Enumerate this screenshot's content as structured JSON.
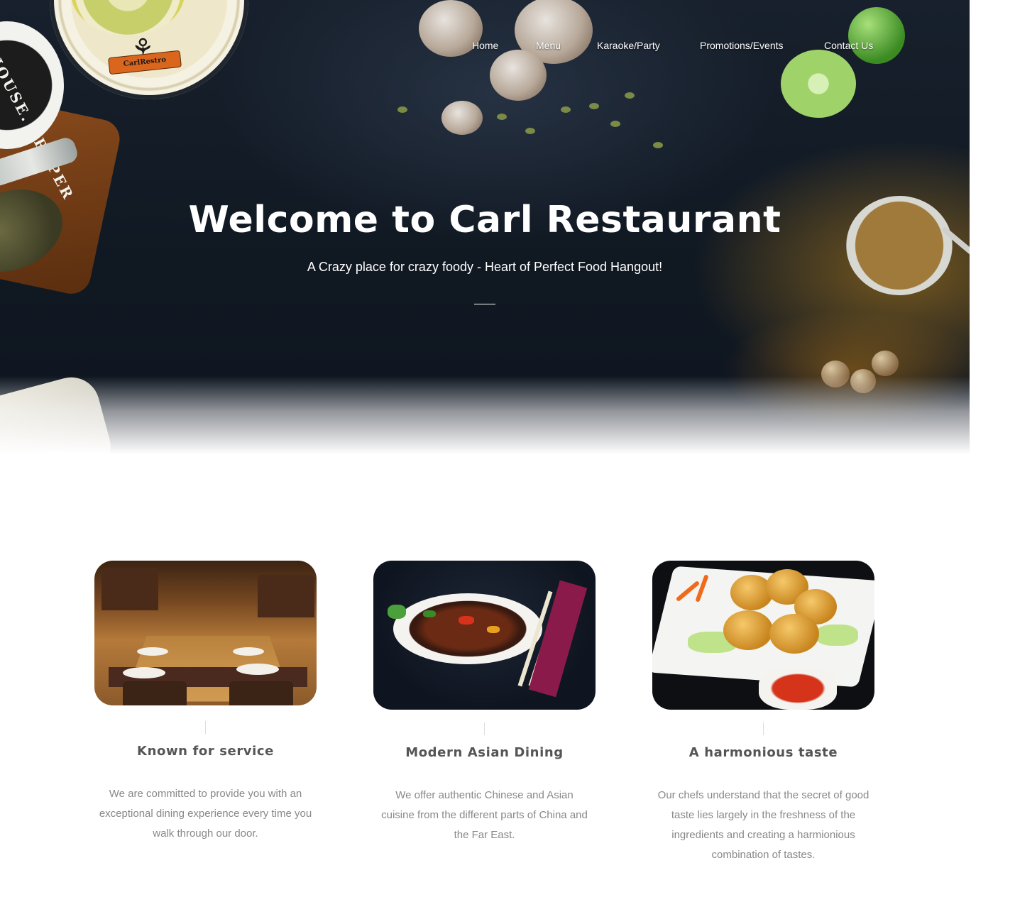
{
  "nav": {
    "items": [
      "Home",
      "Menu",
      "Karaoke/Party",
      "Promotions/Events",
      "Contact Us"
    ]
  },
  "hero": {
    "title": "Welcome to Carl Restaurant",
    "subtitle": "A Crazy place for crazy foody - Heart of Perfect Food Hangout!",
    "logo_text": "CarlRestro",
    "tin_text": "HOUSE. PROPER"
  },
  "features": [
    {
      "title": "Known for service",
      "description": "We are committed to provide you with an exceptional dining experience every time you walk through our door.",
      "image": "restaurant-dining-room-photo"
    },
    {
      "title": "Modern Asian Dining",
      "description": "We offer authentic Chinese and Asian cuisine from the different parts of China and the Far East.",
      "image": "asian-dish-photo"
    },
    {
      "title": "A harmonious taste",
      "description": "Our chefs understand that the secret of good taste lies largely in the freshness of the ingredients and creating a harmionious combination of tastes.",
      "image": "fried-shrimp-photo"
    }
  ]
}
